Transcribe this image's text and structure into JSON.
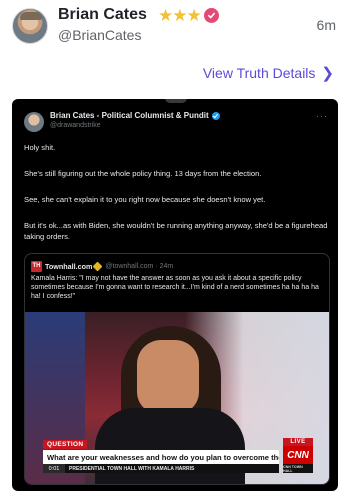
{
  "post": {
    "display_name": "Brian Cates",
    "stars": [
      "★",
      "★",
      "★"
    ],
    "handle": "@BrianCates",
    "time": "6m",
    "view_details": "View Truth Details",
    "chevron": "❯"
  },
  "embed": {
    "author_name": "Brian Cates - Political Columnist & Pundit",
    "author_handle": "@drawandstrike",
    "more": "···",
    "paragraphs": [
      "Holy shit.",
      "She's still figuring out the whole policy thing. 13 days from the election.",
      "See, she can't explain it to you right now because she doesn't know yet.",
      "But it's ok...as with Biden, she wouldn't be running anything anyway, she'd be a figurehead taking orders."
    ],
    "quote": {
      "logo_text": "TH",
      "name": "Townhall.com",
      "meta": "@townhall.com · 24m",
      "text": "Kamala Harris: \"I may not have the answer as soon as you ask it about a specific policy sometimes because I'm gonna want to research it...I'm kind of a nerd sometimes ha ha ha ha ha! I confess!\"",
      "video": {
        "chyron_label": "QUESTION",
        "chyron_text": "What are your weaknesses and how do you plan to overcome them?",
        "timestamp": "0:01",
        "subtitle": "PRESIDENTIAL TOWN HALL WITH KAMALA HARRIS",
        "live": "LIVE",
        "network": "CNN",
        "network_sub": "CNN TOWN HALL"
      }
    }
  },
  "colors": {
    "star": "#f2c232",
    "verified_pink": "#e14a77",
    "link_purple": "#5b4ad8",
    "x_verified_blue": "#1d9bf0",
    "cnn_red": "#cc0000"
  }
}
